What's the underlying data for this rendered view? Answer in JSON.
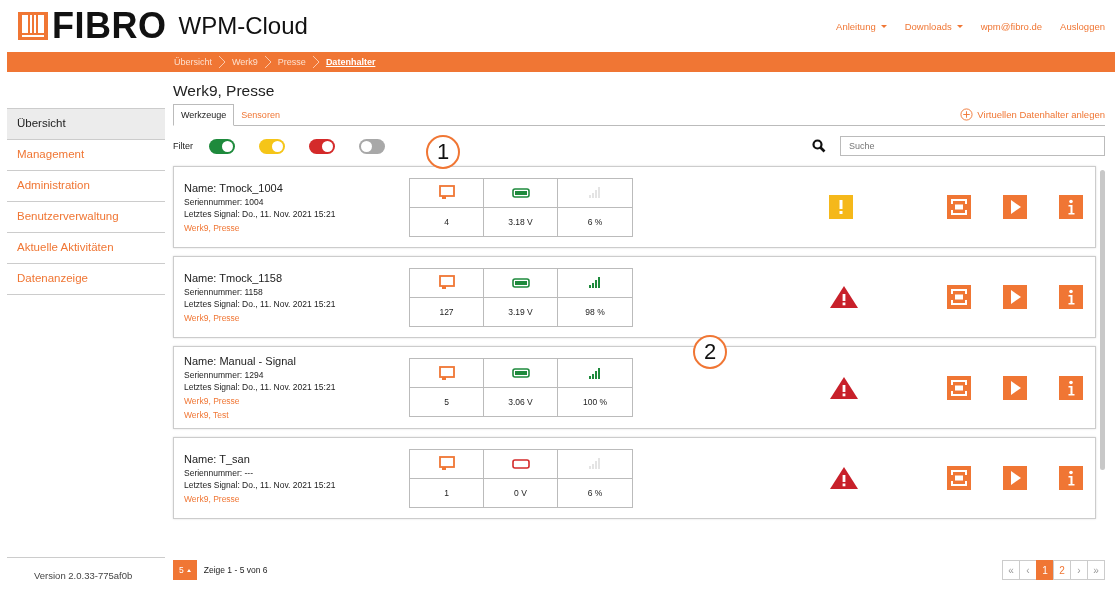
{
  "header": {
    "brand": "FIBRO",
    "product": "WPM-Cloud",
    "nav": [
      {
        "label": "Anleitung",
        "dropdown": true
      },
      {
        "label": "Downloads",
        "dropdown": true
      },
      {
        "label": "wpm@fibro.de",
        "dropdown": false
      },
      {
        "label": "Ausloggen",
        "dropdown": false
      }
    ]
  },
  "breadcrumb": [
    {
      "label": "Übersicht",
      "current": false
    },
    {
      "label": "Werk9",
      "current": false
    },
    {
      "label": "Presse",
      "current": false
    },
    {
      "label": "Datenhalter",
      "current": true
    }
  ],
  "sidebar": {
    "items": [
      {
        "label": "Übersicht",
        "selected": true
      },
      {
        "label": "Management",
        "selected": false
      },
      {
        "label": "Administration",
        "selected": false
      },
      {
        "label": "Benutzerverwaltung",
        "selected": false
      },
      {
        "label": "Aktuelle Aktivitäten",
        "selected": false
      },
      {
        "label": "Datenanzeige",
        "selected": false
      }
    ],
    "version": "Version 2.0.33-775af0b"
  },
  "page_title": "Werk9, Presse",
  "tabs": [
    {
      "label": "Werkzeuge",
      "selected": true
    },
    {
      "label": "Sensoren",
      "selected": false
    }
  ],
  "add_link": "Virtuellen Datenhalter anlegen",
  "filter": {
    "label": "Filter",
    "toggles": [
      {
        "color": "#1e8a3c",
        "on": true
      },
      {
        "color": "#f5c518",
        "on": true
      },
      {
        "color": "#d42a2a",
        "on": true
      },
      {
        "color": "#a8a8a8",
        "on": false
      }
    ]
  },
  "search": {
    "placeholder": "Suche"
  },
  "callouts": [
    "1",
    "2"
  ],
  "holders": [
    {
      "name": "Name: Tmock_1004",
      "serial": "Seriennummer: 1004",
      "last_signal": "Letztes Signal: Do., 11. Nov. 2021 15:21",
      "locations": [
        "Werk9, Presse"
      ],
      "count": "4",
      "voltage": "3.18 V",
      "battery_ok": true,
      "signal": "6 %",
      "signal_active": false,
      "kind": "warning"
    },
    {
      "name": "Name: Tmock_1158",
      "serial": "Seriennummer: 1158",
      "last_signal": "Letztes Signal: Do., 11. Nov. 2021 15:21",
      "locations": [
        "Werk9, Presse"
      ],
      "count": "127",
      "voltage": "3.19 V",
      "battery_ok": true,
      "signal": "98 %",
      "signal_active": true,
      "kind": "alert"
    },
    {
      "name": "Name: Manual - Signal",
      "serial": "Seriennummer: 1294",
      "last_signal": "Letztes Signal: Do., 11. Nov. 2021 15:21",
      "locations": [
        "Werk9, Presse",
        "Werk9, Test"
      ],
      "count": "5",
      "voltage": "3.06 V",
      "battery_ok": true,
      "signal": "100 %",
      "signal_active": true,
      "kind": "alert"
    },
    {
      "name": "Name: T_san",
      "serial": "Seriennummer: ---",
      "last_signal": "Letztes Signal: Do., 11. Nov. 2021 15:21",
      "locations": [
        "Werk9, Presse"
      ],
      "count": "1",
      "voltage": "0 V",
      "battery_ok": false,
      "signal": "6 %",
      "signal_active": false,
      "kind": "alert"
    }
  ],
  "footer": {
    "page_size": "5",
    "summary": "Zeige 1 - 5 von 6",
    "pages": [
      {
        "label": "«",
        "kind": "nav",
        "selected": false
      },
      {
        "label": "‹",
        "kind": "nav",
        "selected": false
      },
      {
        "label": "1",
        "kind": "page",
        "selected": true
      },
      {
        "label": "2",
        "kind": "page",
        "selected": false
      },
      {
        "label": "›",
        "kind": "nav",
        "selected": false
      },
      {
        "label": "»",
        "kind": "nav",
        "selected": false
      }
    ]
  }
}
